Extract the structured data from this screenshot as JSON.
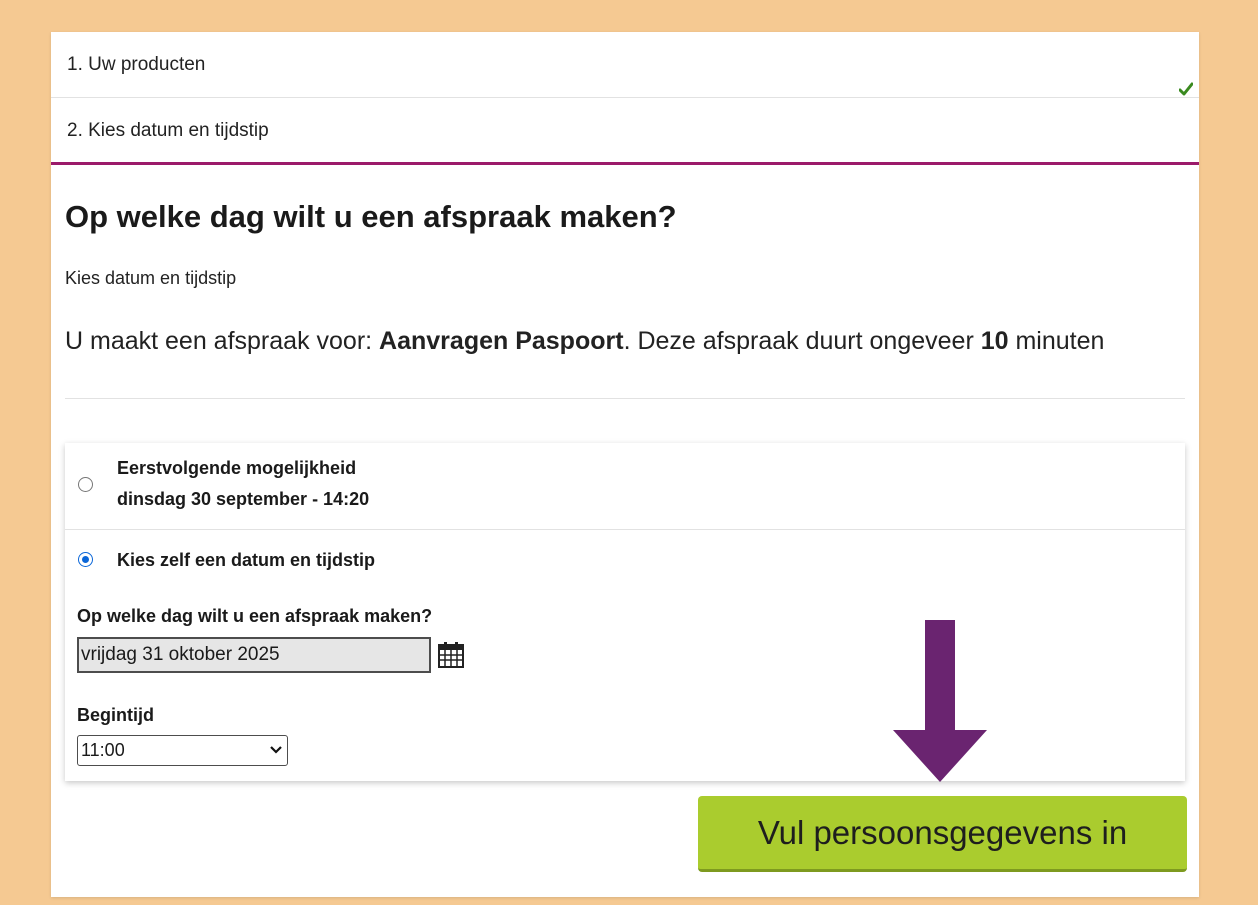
{
  "steps": [
    {
      "label": "1. Uw producten",
      "completed": true
    },
    {
      "label": "2. Kies datum en tijdstip",
      "active": true
    }
  ],
  "main": {
    "title": "Op welke dag wilt u een afspraak maken?",
    "subtitle": "Kies datum en tijdstip",
    "info": {
      "prefix": "U maakt een afspraak voor: ",
      "product": "Aanvragen Paspoort",
      "middle": ". Deze afspraak duurt ongeveer ",
      "duration": "10",
      "suffix": " minuten"
    }
  },
  "options": {
    "first": {
      "label": "Eerstvolgende mogelijkheid",
      "value": "dinsdag 30 september - 14:20",
      "selected": false
    },
    "custom": {
      "label": "Kies zelf een datum en tijdstip",
      "selected": true
    }
  },
  "form": {
    "date_label": "Op welke dag wilt u een afspraak maken?",
    "date_value": "vrijdag 31 oktober 2025",
    "time_label": "Begintijd",
    "time_value": "11:00"
  },
  "cta": {
    "label": "Vul persoonsgegevens in"
  },
  "colors": {
    "background": "#f5c992",
    "active_step_border": "#9b1a6a",
    "check": "#3a8a1f",
    "radio_selected": "#0a66d8",
    "arrow": "#6a2470",
    "cta": "#aacc2e"
  },
  "icons": {
    "step1": "checkmark-icon",
    "date": "calendar-icon",
    "select": "chevron-down-icon",
    "pointer": "arrow-down-icon"
  }
}
